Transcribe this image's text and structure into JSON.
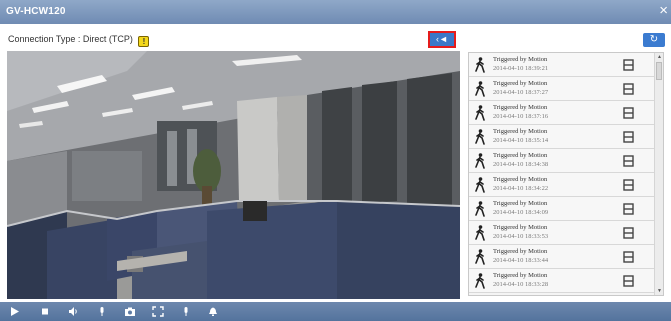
{
  "window": {
    "title": "GV-HCW120",
    "close_glyph": "×"
  },
  "connection": {
    "label": "Connection Type : Direct (TCP)",
    "warning_glyph": "!"
  },
  "toolbar": {
    "collapse_glyph": "‹◄",
    "refresh_glyph": "↻"
  },
  "events": [
    {
      "type": "Triggered by Motion",
      "time": "2014-04-10 18:39:21"
    },
    {
      "type": "Triggered by Motion",
      "time": "2014-04-10 18:37:27"
    },
    {
      "type": "Triggered by Motion",
      "time": "2014-04-10 18:37:16"
    },
    {
      "type": "Triggered by Motion",
      "time": "2014-04-10 18:35:14"
    },
    {
      "type": "Triggered by Motion",
      "time": "2014-04-10 18:34:38"
    },
    {
      "type": "Triggered by Motion",
      "time": "2014-04-10 18:34:22"
    },
    {
      "type": "Triggered by Motion",
      "time": "2014-04-10 18:34:09"
    },
    {
      "type": "Triggered by Motion",
      "time": "2014-04-10 18:33:53"
    },
    {
      "type": "Triggered by Motion",
      "time": "2014-04-10 18:33:44"
    },
    {
      "type": "Triggered by Motion",
      "time": "2014-04-10 18:33:28"
    }
  ],
  "controls": [
    "play-icon",
    "stop-icon",
    "speaker-icon",
    "microphone-icon",
    "camera-snapshot-icon",
    "fullscreen-icon",
    "microphone-talk-icon",
    "alarm-bell-icon"
  ],
  "colors": {
    "titlebar": "#7f99bf",
    "controlbar": "#5f7ca5",
    "accent_blue": "#3b7bd0",
    "highlight_red": "#e51c1c",
    "warning_yellow": "#f4d81a"
  }
}
